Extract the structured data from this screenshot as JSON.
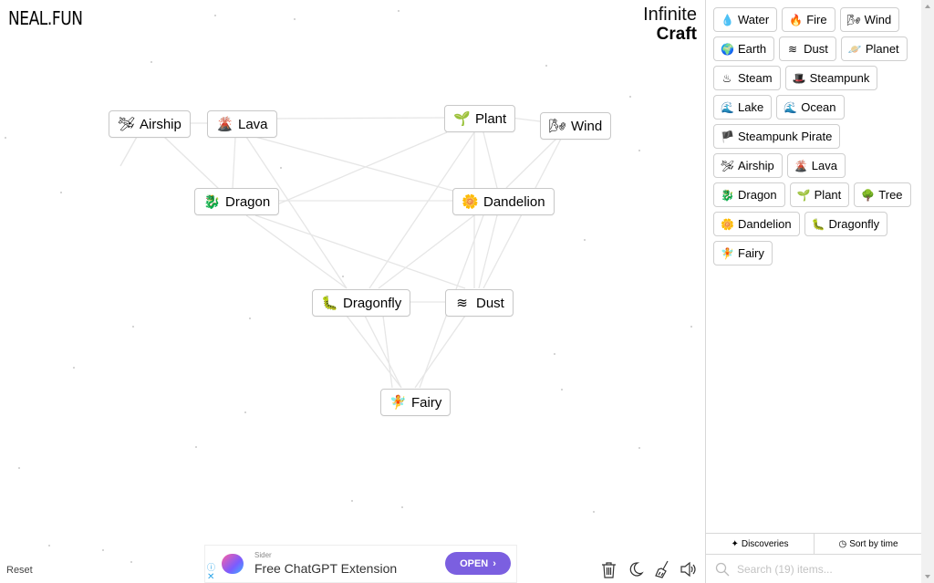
{
  "header": {
    "site_logo": "NEAL.FUN",
    "app_title_line1": "Infinite",
    "app_title_line2": "Craft"
  },
  "canvas_nodes": [
    {
      "id": "airship",
      "label": "Airship",
      "icon": "airship-icon",
      "emoji": "🛩",
      "color": "#e7c21a"
    },
    {
      "id": "lava",
      "label": "Lava",
      "icon": "volcano-icon",
      "emoji": "🌋",
      "color": "#d8401a"
    },
    {
      "id": "plant",
      "label": "Plant",
      "icon": "seedling-icon",
      "emoji": "🌱",
      "color": "#6bb22c"
    },
    {
      "id": "wind",
      "label": "Wind",
      "icon": "wind-icon",
      "emoji": "🌬",
      "color": "#3cb0e8"
    },
    {
      "id": "dragon",
      "label": "Dragon",
      "icon": "dragon-icon",
      "emoji": "🐉",
      "color": "#5da532"
    },
    {
      "id": "dandelion",
      "label": "Dandelion",
      "icon": "flower-icon",
      "emoji": "🌼",
      "color": "#e8a84a"
    },
    {
      "id": "dragonfly",
      "label": "Dragonfly",
      "icon": "caterpillar-icon",
      "emoji": "🐛",
      "color": "#6bb22c"
    },
    {
      "id": "dust",
      "label": "Dust",
      "icon": "waves-icon",
      "emoji": "≋",
      "color": "#333333"
    },
    {
      "id": "fairy",
      "label": "Fairy",
      "icon": "fairy-icon",
      "emoji": "🧚",
      "color": "#e7c21a"
    }
  ],
  "sidebar": {
    "items": [
      {
        "label": "Water",
        "icon": "droplet-icon",
        "emoji": "💧"
      },
      {
        "label": "Fire",
        "icon": "fire-icon",
        "emoji": "🔥"
      },
      {
        "label": "Wind",
        "icon": "wind-icon",
        "emoji": "🌬"
      },
      {
        "label": "Earth",
        "icon": "globe-icon",
        "emoji": "🌍"
      },
      {
        "label": "Dust",
        "icon": "waves-icon",
        "emoji": "≋"
      },
      {
        "label": "Planet",
        "icon": "planet-icon",
        "emoji": "🪐"
      },
      {
        "label": "Steam",
        "icon": "steam-icon",
        "emoji": "♨"
      },
      {
        "label": "Steampunk",
        "icon": "top-hat-icon",
        "emoji": "🎩"
      },
      {
        "label": "Lake",
        "icon": "wave-icon",
        "emoji": "🌊"
      },
      {
        "label": "Ocean",
        "icon": "wave-icon",
        "emoji": "🌊"
      },
      {
        "label": "Steampunk Pirate",
        "icon": "flag-icon",
        "emoji": "🏴"
      },
      {
        "label": "Airship",
        "icon": "airship-icon",
        "emoji": "🛩"
      },
      {
        "label": "Lava",
        "icon": "volcano-icon",
        "emoji": "🌋"
      },
      {
        "label": "Dragon",
        "icon": "dragon-icon",
        "emoji": "🐉"
      },
      {
        "label": "Plant",
        "icon": "seedling-icon",
        "emoji": "🌱"
      },
      {
        "label": "Tree",
        "icon": "tree-icon",
        "emoji": "🌳"
      },
      {
        "label": "Dandelion",
        "icon": "flower-icon",
        "emoji": "🌼"
      },
      {
        "label": "Dragonfly",
        "icon": "caterpillar-icon",
        "emoji": "🐛"
      },
      {
        "label": "Fairy",
        "icon": "fairy-icon",
        "emoji": "🧚"
      }
    ],
    "discoveries_label": "Discoveries",
    "sort_label": "Sort by time",
    "search_placeholder": "Search (19) items..."
  },
  "footer": {
    "reset_label": "Reset"
  },
  "ad": {
    "sponsor": "Sider",
    "headline": "Free ChatGPT Extension",
    "cta": "OPEN",
    "info_glyph": "ⓘ",
    "close_glyph": "✕",
    "accent": "#7b5fe0"
  },
  "tools": [
    {
      "name": "trash-icon"
    },
    {
      "name": "moon-icon"
    },
    {
      "name": "broom-icon"
    },
    {
      "name": "speaker-icon"
    }
  ]
}
